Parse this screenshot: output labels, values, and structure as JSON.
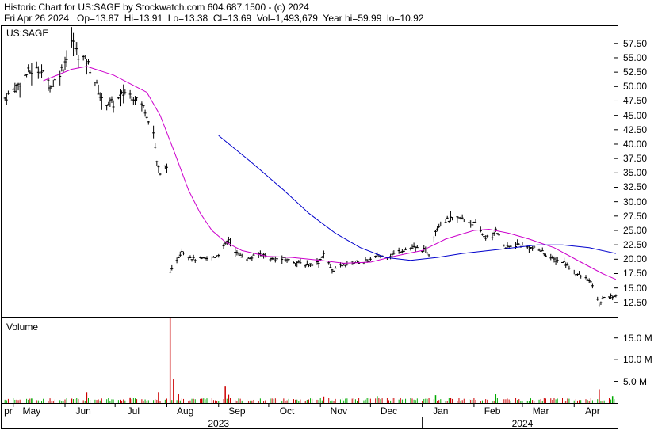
{
  "header": {
    "line1": "Historic Chart for US:SAGE by Stockwatch.com 604.687.1500 - (c) 2024",
    "line2": "Fri Apr 26 2024   Op=13.87  Hi=13.91  Lo=13.38  Cl=13.69  Vol=1,493,679  Year hi=59.99  lo=10.92"
  },
  "colors": {
    "price_bars": "#000000",
    "ma_short": "#cc00cc",
    "ma_long": "#0000cc",
    "volume_up": "#00aa00",
    "volume_down": "#cc0000",
    "frame": "#000000"
  },
  "chart_data": [
    {
      "type": "ohlc",
      "symbol_label": "US:SAGE",
      "title": "Historic Chart for US:SAGE by Stockwatch.com 604.687.1500 - (c) 2024",
      "y_ticks": [
        "57.50",
        "55.00",
        "52.50",
        "50.00",
        "47.50",
        "45.00",
        "42.50",
        "40.00",
        "37.50",
        "35.00",
        "32.50",
        "30.00",
        "27.50",
        "25.00",
        "22.50",
        "20.00",
        "17.50",
        "15.00",
        "12.50"
      ],
      "ylim": [
        10.0,
        60.5
      ],
      "grid": false,
      "price_points": [
        {
          "d": "2023-04-26",
          "c": 48.0
        },
        {
          "d": "2023-05-03",
          "c": 50.0
        },
        {
          "d": "2023-05-10",
          "c": 52.5
        },
        {
          "d": "2023-05-17",
          "c": 53.0
        },
        {
          "d": "2023-05-24",
          "c": 50.0
        },
        {
          "d": "2023-05-31",
          "c": 53.5
        },
        {
          "d": "2023-06-05",
          "c": 58.0
        },
        {
          "d": "2023-06-09",
          "c": 55.5
        },
        {
          "d": "2023-06-14",
          "c": 54.5
        },
        {
          "d": "2023-06-19",
          "c": 51.0
        },
        {
          "d": "2023-06-23",
          "c": 47.5
        },
        {
          "d": "2023-06-30",
          "c": 47.0
        },
        {
          "d": "2023-07-07",
          "c": 49.0
        },
        {
          "d": "2023-07-14",
          "c": 48.0
        },
        {
          "d": "2023-07-19",
          "c": 46.0
        },
        {
          "d": "2023-07-24",
          "c": 42.0
        },
        {
          "d": "2023-07-26",
          "c": 37.0
        },
        {
          "d": "2023-07-28",
          "c": 34.5
        },
        {
          "d": "2023-08-01",
          "c": 36.5
        },
        {
          "d": "2023-08-03",
          "c": 17.5
        },
        {
          "d": "2023-08-07",
          "c": 20.0
        },
        {
          "d": "2023-08-10",
          "c": 21.5
        },
        {
          "d": "2023-08-17",
          "c": 20.0
        },
        {
          "d": "2023-08-24",
          "c": 20.0
        },
        {
          "d": "2023-08-31",
          "c": 20.5
        },
        {
          "d": "2023-09-05",
          "c": 22.5
        },
        {
          "d": "2023-09-07",
          "c": 23.5
        },
        {
          "d": "2023-09-12",
          "c": 21.0
        },
        {
          "d": "2023-09-19",
          "c": 20.0
        },
        {
          "d": "2023-09-26",
          "c": 21.0
        },
        {
          "d": "2023-10-03",
          "c": 20.0
        },
        {
          "d": "2023-10-10",
          "c": 20.0
        },
        {
          "d": "2023-10-17",
          "c": 19.5
        },
        {
          "d": "2023-10-24",
          "c": 19.0
        },
        {
          "d": "2023-10-31",
          "c": 19.5
        },
        {
          "d": "2023-11-03",
          "c": 21.0
        },
        {
          "d": "2023-11-08",
          "c": 18.0
        },
        {
          "d": "2023-11-14",
          "c": 19.0
        },
        {
          "d": "2023-11-21",
          "c": 19.5
        },
        {
          "d": "2023-11-28",
          "c": 19.5
        },
        {
          "d": "2023-12-05",
          "c": 20.5
        },
        {
          "d": "2023-12-12",
          "c": 20.5
        },
        {
          "d": "2023-12-19",
          "c": 21.5
        },
        {
          "d": "2023-12-27",
          "c": 22.0
        },
        {
          "d": "2024-01-03",
          "c": 21.5
        },
        {
          "d": "2024-01-05",
          "c": 21.0
        },
        {
          "d": "2024-01-09",
          "c": 25.0
        },
        {
          "d": "2024-01-12",
          "c": 26.5
        },
        {
          "d": "2024-01-19",
          "c": 27.0
        },
        {
          "d": "2024-01-26",
          "c": 27.0
        },
        {
          "d": "2024-02-02",
          "c": 26.0
        },
        {
          "d": "2024-02-07",
          "c": 24.0
        },
        {
          "d": "2024-02-12",
          "c": 23.5
        },
        {
          "d": "2024-02-14",
          "c": 25.5
        },
        {
          "d": "2024-02-16",
          "c": 24.0
        },
        {
          "d": "2024-02-20",
          "c": 22.0
        },
        {
          "d": "2024-02-27",
          "c": 22.5
        },
        {
          "d": "2024-03-05",
          "c": 22.0
        },
        {
          "d": "2024-03-12",
          "c": 21.5
        },
        {
          "d": "2024-03-19",
          "c": 20.0
        },
        {
          "d": "2024-03-26",
          "c": 19.5
        },
        {
          "d": "2024-04-02",
          "c": 17.5
        },
        {
          "d": "2024-04-09",
          "c": 16.5
        },
        {
          "d": "2024-04-12",
          "c": 15.5
        },
        {
          "d": "2024-04-16",
          "c": 12.0
        },
        {
          "d": "2024-04-19",
          "c": 13.5
        },
        {
          "d": "2024-04-24",
          "c": 13.5
        },
        {
          "d": "2024-04-26",
          "c": 13.69
        }
      ],
      "gaps": [
        {
          "after": "2023-08-01"
        }
      ],
      "ma_short": [
        {
          "d": "2023-05-19",
          "v": 51.0
        },
        {
          "d": "2023-06-05",
          "v": 53.0
        },
        {
          "d": "2023-06-14",
          "v": 53.5
        },
        {
          "d": "2023-06-30",
          "v": 52.0
        },
        {
          "d": "2023-07-10",
          "v": 50.5
        },
        {
          "d": "2023-07-20",
          "v": 49.0
        },
        {
          "d": "2023-07-28",
          "v": 45.0
        },
        {
          "d": "2023-08-05",
          "v": 39.0
        },
        {
          "d": "2023-08-14",
          "v": 32.0
        },
        {
          "d": "2023-08-21",
          "v": 28.0
        },
        {
          "d": "2023-08-28",
          "v": 25.0
        },
        {
          "d": "2023-09-05",
          "v": 23.0
        },
        {
          "d": "2023-09-15",
          "v": 21.5
        },
        {
          "d": "2023-09-30",
          "v": 20.5
        },
        {
          "d": "2023-10-15",
          "v": 20.3
        },
        {
          "d": "2023-11-01",
          "v": 19.8
        },
        {
          "d": "2023-11-15",
          "v": 19.3
        },
        {
          "d": "2023-12-01",
          "v": 19.5
        },
        {
          "d": "2023-12-15",
          "v": 20.5
        },
        {
          "d": "2024-01-01",
          "v": 21.5
        },
        {
          "d": "2024-01-15",
          "v": 23.5
        },
        {
          "d": "2024-02-01",
          "v": 25.0
        },
        {
          "d": "2024-02-10",
          "v": 25.2
        },
        {
          "d": "2024-02-22",
          "v": 24.5
        },
        {
          "d": "2024-03-05",
          "v": 23.5
        },
        {
          "d": "2024-03-20",
          "v": 22.0
        },
        {
          "d": "2024-04-05",
          "v": 19.5
        },
        {
          "d": "2024-04-18",
          "v": 17.5
        },
        {
          "d": "2024-04-26",
          "v": 16.5
        }
      ],
      "ma_long": [
        {
          "d": "2023-09-01",
          "v": 41.5
        },
        {
          "d": "2023-09-20",
          "v": 37.0
        },
        {
          "d": "2023-10-10",
          "v": 32.0
        },
        {
          "d": "2023-10-25",
          "v": 28.0
        },
        {
          "d": "2023-11-10",
          "v": 24.5
        },
        {
          "d": "2023-11-25",
          "v": 22.0
        },
        {
          "d": "2023-12-10",
          "v": 20.3
        },
        {
          "d": "2023-12-25",
          "v": 19.8
        },
        {
          "d": "2024-01-10",
          "v": 20.3
        },
        {
          "d": "2024-01-25",
          "v": 21.0
        },
        {
          "d": "2024-02-10",
          "v": 21.5
        },
        {
          "d": "2024-02-25",
          "v": 22.0
        },
        {
          "d": "2024-03-10",
          "v": 22.5
        },
        {
          "d": "2024-03-25",
          "v": 22.5
        },
        {
          "d": "2024-04-10",
          "v": 22.0
        },
        {
          "d": "2024-04-26",
          "v": 21.0
        }
      ]
    },
    {
      "type": "bar",
      "title": "Volume",
      "y_ticks": [
        "15.0 M",
        "10.0 M",
        "5.0 M"
      ],
      "ylim": [
        0,
        19.5
      ],
      "unit": "M",
      "base_level": 0.8,
      "spikes": [
        {
          "d": "2023-05-12",
          "v": 0.9,
          "up": true
        },
        {
          "d": "2023-06-05",
          "v": 1.0,
          "up": false
        },
        {
          "d": "2023-06-14",
          "v": 2.5,
          "up": false
        },
        {
          "d": "2023-07-10",
          "v": 1.3,
          "up": false
        },
        {
          "d": "2023-07-27",
          "v": 2.5,
          "up": false
        },
        {
          "d": "2023-08-03",
          "v": 19.5,
          "up": false
        },
        {
          "d": "2023-08-05",
          "v": 5.5,
          "up": false
        },
        {
          "d": "2023-08-08",
          "v": 2.0,
          "up": false
        },
        {
          "d": "2023-08-22",
          "v": 1.0,
          "up": false
        },
        {
          "d": "2023-09-05",
          "v": 3.8,
          "up": false
        },
        {
          "d": "2023-09-07",
          "v": 1.9,
          "up": false
        },
        {
          "d": "2023-11-03",
          "v": 1.5,
          "up": false
        },
        {
          "d": "2023-12-05",
          "v": 1.6,
          "up": true
        },
        {
          "d": "2024-01-09",
          "v": 1.8,
          "up": true
        },
        {
          "d": "2024-01-18",
          "v": 1.2,
          "up": false
        },
        {
          "d": "2024-02-14",
          "v": 2.0,
          "up": true
        },
        {
          "d": "2024-04-16",
          "v": 3.2,
          "up": false
        },
        {
          "d": "2024-04-24",
          "v": 1.6,
          "up": true
        }
      ]
    }
  ],
  "x_axis": {
    "month_labels": [
      {
        "d": "2023-04-28",
        "text": "pr"
      },
      {
        "d": "2023-05-12",
        "text": "May"
      },
      {
        "d": "2023-06-12",
        "text": "Jun"
      },
      {
        "d": "2023-07-12",
        "text": "Jul"
      },
      {
        "d": "2023-08-12",
        "text": "Aug"
      },
      {
        "d": "2023-09-12",
        "text": "Sep"
      },
      {
        "d": "2023-10-12",
        "text": "Oct"
      },
      {
        "d": "2023-11-12",
        "text": "Nov"
      },
      {
        "d": "2023-12-12",
        "text": "Dec"
      },
      {
        "d": "2024-01-12",
        "text": "Jan"
      },
      {
        "d": "2024-02-12",
        "text": "Feb"
      },
      {
        "d": "2024-03-12",
        "text": "Mar"
      },
      {
        "d": "2024-04-12",
        "text": "Apr"
      }
    ],
    "month_starts": [
      "2023-05-01",
      "2023-06-01",
      "2023-07-01",
      "2023-08-01",
      "2023-09-01",
      "2023-10-01",
      "2023-11-01",
      "2023-12-01",
      "2024-01-01",
      "2024-02-01",
      "2024-03-01",
      "2024-04-01"
    ],
    "years": [
      {
        "d": "2023-09-01",
        "text": "2023"
      },
      {
        "d": "2024-03-01",
        "text": "2024"
      }
    ],
    "year_divider": "2024-01-01",
    "start": "2023-04-24",
    "end": "2024-04-27"
  }
}
